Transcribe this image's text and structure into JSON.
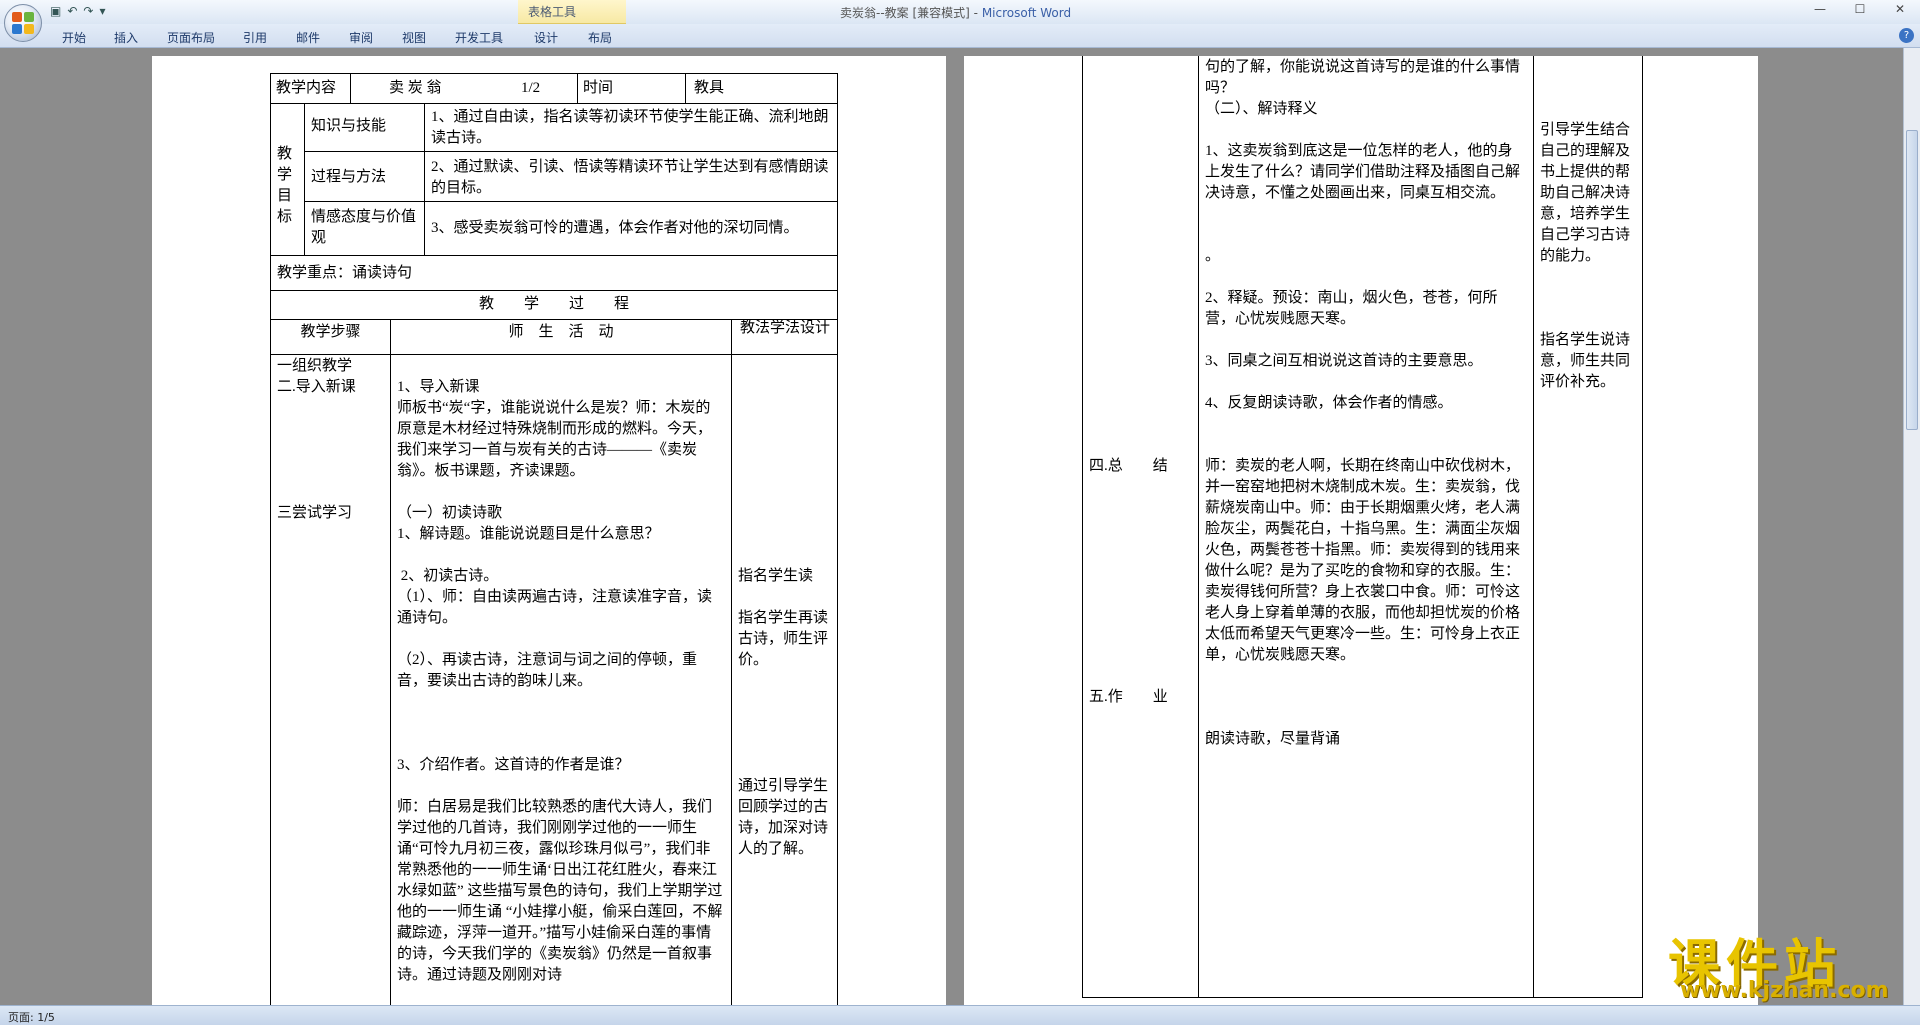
{
  "window": {
    "title": "卖炭翁--教案 [兼容模式] - ",
    "app": "Microsoft Word",
    "contextual_tab_group": "表格工具"
  },
  "ribbon_tabs": [
    "开始",
    "插入",
    "页面布局",
    "引用",
    "邮件",
    "审阅",
    "视图",
    "开发工具",
    "设计",
    "布局"
  ],
  "status": {
    "page": "页面: 1/5"
  },
  "watermark": {
    "cn": "课件站",
    "url": "www.kjzhan.com"
  },
  "page1": {
    "header": {
      "label": "教学内容",
      "title": "卖 炭 翁",
      "period": "1/2",
      "time_label": "时间",
      "aids_label": "教具"
    },
    "objectives": {
      "label": "教学目标",
      "rows": [
        {
          "dim": "知识与技能",
          "text": "1、通过自由读，指名读等初读环节使学生能正确、流利地朗读古诗。"
        },
        {
          "dim": "过程与方法",
          "text": "2、通过默读、引读、悟读等精读环节让学生达到有感情朗读的目标。"
        },
        {
          "dim": "情感态度与价值观",
          "text": "3、感受卖炭翁可怜的遭遇，体会作者对他的深切同情。"
        }
      ]
    },
    "focus": "教学重点：诵读诗句",
    "process_title": "教　　学　　过　　程",
    "col_headers": {
      "steps": "教学步骤",
      "activities": "师　生　活　动",
      "design": "教法学法设计"
    },
    "steps_text": "一组织教学\n二.导入新课\n\n\n\n\n\n三尝试学习",
    "activities_text": "\n1、导入新课\n师板书“炭“字，谁能说说什么是炭？师：木炭的原意是木材经过特殊烧制而形成的燃料。今天，我们来学习一首与炭有关的古诗———《卖炭翁》。板书课题，齐读课题。\n\n（一）初读诗歌\n1、解诗题。谁能说说题目是什么意思？\n\n 2、初读古诗。\n（1）、师：自由读两遍古诗，注意读准字音，读通诗句。\n\n（2）、再读古诗，注意词与词之间的停顿，重音，要读出古诗的韵味儿来。\n\n\n\n3、介绍作者。这首诗的作者是谁？\n\n师：白居易是我们比较熟悉的唐代大诗人，我们学过他的几首诗，我们刚刚学过他的一一师生诵“可怜九月初三夜，露似珍珠月似弓”，我们非常熟悉他的一一师生诵‘日出江花红胜火，春来江水绿如蓝” 这些描写景色的诗句，我们上学期学过他的一一师生诵 “小娃撑小艇，偷采白莲回，不解藏踪迹，浮萍一道开。”描写小娃偷采白莲的事情的诗，今天我们学的《卖炭翁》仍然是一首叙事诗。通过诗题及刚刚对诗",
    "design_text": "\n\n\n\n\n\n\n\n\n\n指名学生读\n\n指名学生再读古诗，师生评价。\n\n\n\n\n\n通过引导学生回顾学过的古诗，加深对诗人的了解。"
  },
  "page2": {
    "steps_text": "\n\n\n\n\n\n\n\n\n\n\n\n\n\n\n\n\n\n\n四.总　　结\n\n\n\n\n\n\n\n\n\n\n五.作　　业",
    "activities_text": "句的了解，你能说说这首诗写的是谁的什么事情吗？\n（二）、解诗释义\n\n1、这卖炭翁到底这是一位怎样的老人，他的身上发生了什么？请同学们借助注释及插图自己解决诗意，不懂之处圈画出来，同桌互相交流。\n\n\n。\n\n2、释疑。预设：南山，烟火色，苍苍，何所营，心忧炭贱愿天寒。\n\n3、同桌之间互相说说这首诗的主要意思。\n\n4、反复朗读诗歌，体会作者的情感。\n\n\n师：卖炭的老人啊，长期在终南山中砍伐树木，并一窑窑地把树木烧制成木炭。生：卖炭翁，伐薪烧炭南山中。师：由于长期烟熏火烤，老人满脸灰尘，两鬓花白，十指乌黑。生：满面尘灰烟火色，两鬓苍苍十指黑。师：卖炭得到的钱用来做什么呢？是为了买吃的食物和穿的衣服。生：卖炭得钱何所营？身上衣裳口中食。师：可怜这老人身上穿着单薄的衣服，而他却担忧炭的价格太低而希望天气更寒冷一些。生：可怜身上衣正单，心忧炭贱愿天寒。\n\n\n\n朗读诗歌，尽量背诵",
    "design_text": "\n\n\n引导学生结合自己的理解及书上提供的帮助自己解决诗意，培养学生自己学习古诗的能力。\n\n\n\n指名学生说诗意，师生共同评价补充。"
  }
}
